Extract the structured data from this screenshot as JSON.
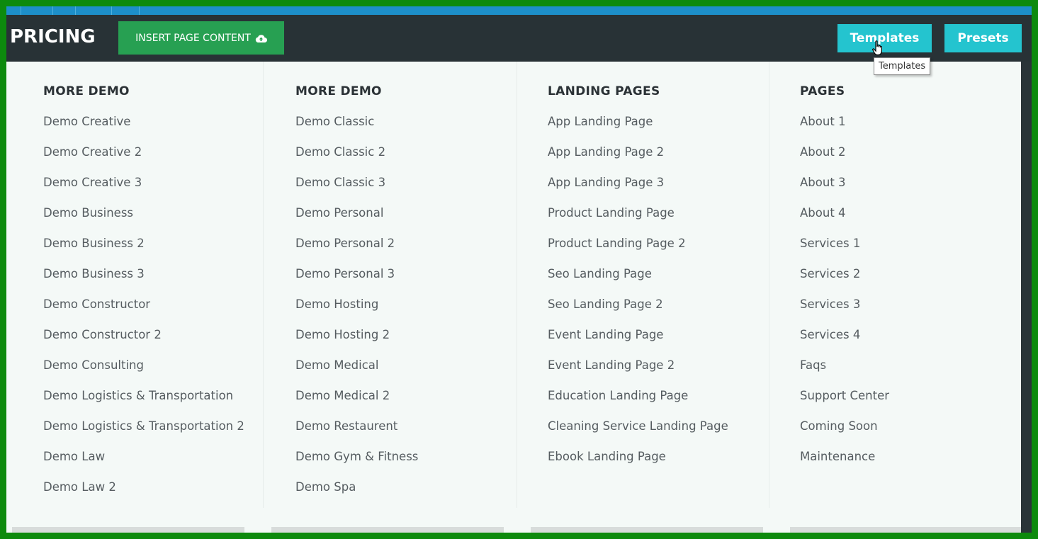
{
  "header": {
    "title": "PRICING",
    "insert_label": "INSERT PAGE CONTENT",
    "templates_label": "Templates",
    "presets_label": "Presets",
    "tooltip": "Templates"
  },
  "colors": {
    "accent": "#24c4cf",
    "insert_button": "#27a052",
    "header_bg": "#283236",
    "menu_bg": "#f4f9f7"
  },
  "menu": {
    "columns": [
      {
        "heading": "MORE DEMO",
        "items": [
          "Demo Creative",
          "Demo Creative 2",
          "Demo Creative 3",
          "Demo Business",
          "Demo Business 2",
          "Demo Business 3",
          "Demo Constructor",
          "Demo Constructor 2",
          "Demo Consulting",
          "Demo Logistics & Transportation",
          "Demo Logistics & Transportation 2",
          "Demo Law",
          "Demo Law 2"
        ]
      },
      {
        "heading": "MORE DEMO",
        "items": [
          "Demo Classic",
          "Demo Classic 2",
          "Demo Classic 3",
          "Demo Personal",
          "Demo Personal 2",
          "Demo Personal 3",
          "Demo Hosting",
          "Demo Hosting 2",
          "Demo Medical",
          "Demo Medical 2",
          "Demo Restaurent",
          "Demo Gym & Fitness",
          "Demo Spa"
        ]
      },
      {
        "heading": "LANDING PAGES",
        "items": [
          "App Landing Page",
          "App Landing Page 2",
          "App Landing Page 3",
          "Product Landing Page",
          "Product Landing Page 2",
          "Seo Landing Page",
          "Seo Landing Page 2",
          "Event Landing Page",
          "Event Landing Page 2",
          "Education Landing Page",
          "Cleaning Service Landing Page",
          "Ebook Landing Page"
        ]
      },
      {
        "heading": "PAGES",
        "items": [
          "About 1",
          "About 2",
          "About 3",
          "About 4",
          "Services 1",
          "Services 2",
          "Services 3",
          "Services 4",
          "Faqs",
          "Support Center",
          "Coming Soon",
          "Maintenance"
        ]
      }
    ]
  }
}
